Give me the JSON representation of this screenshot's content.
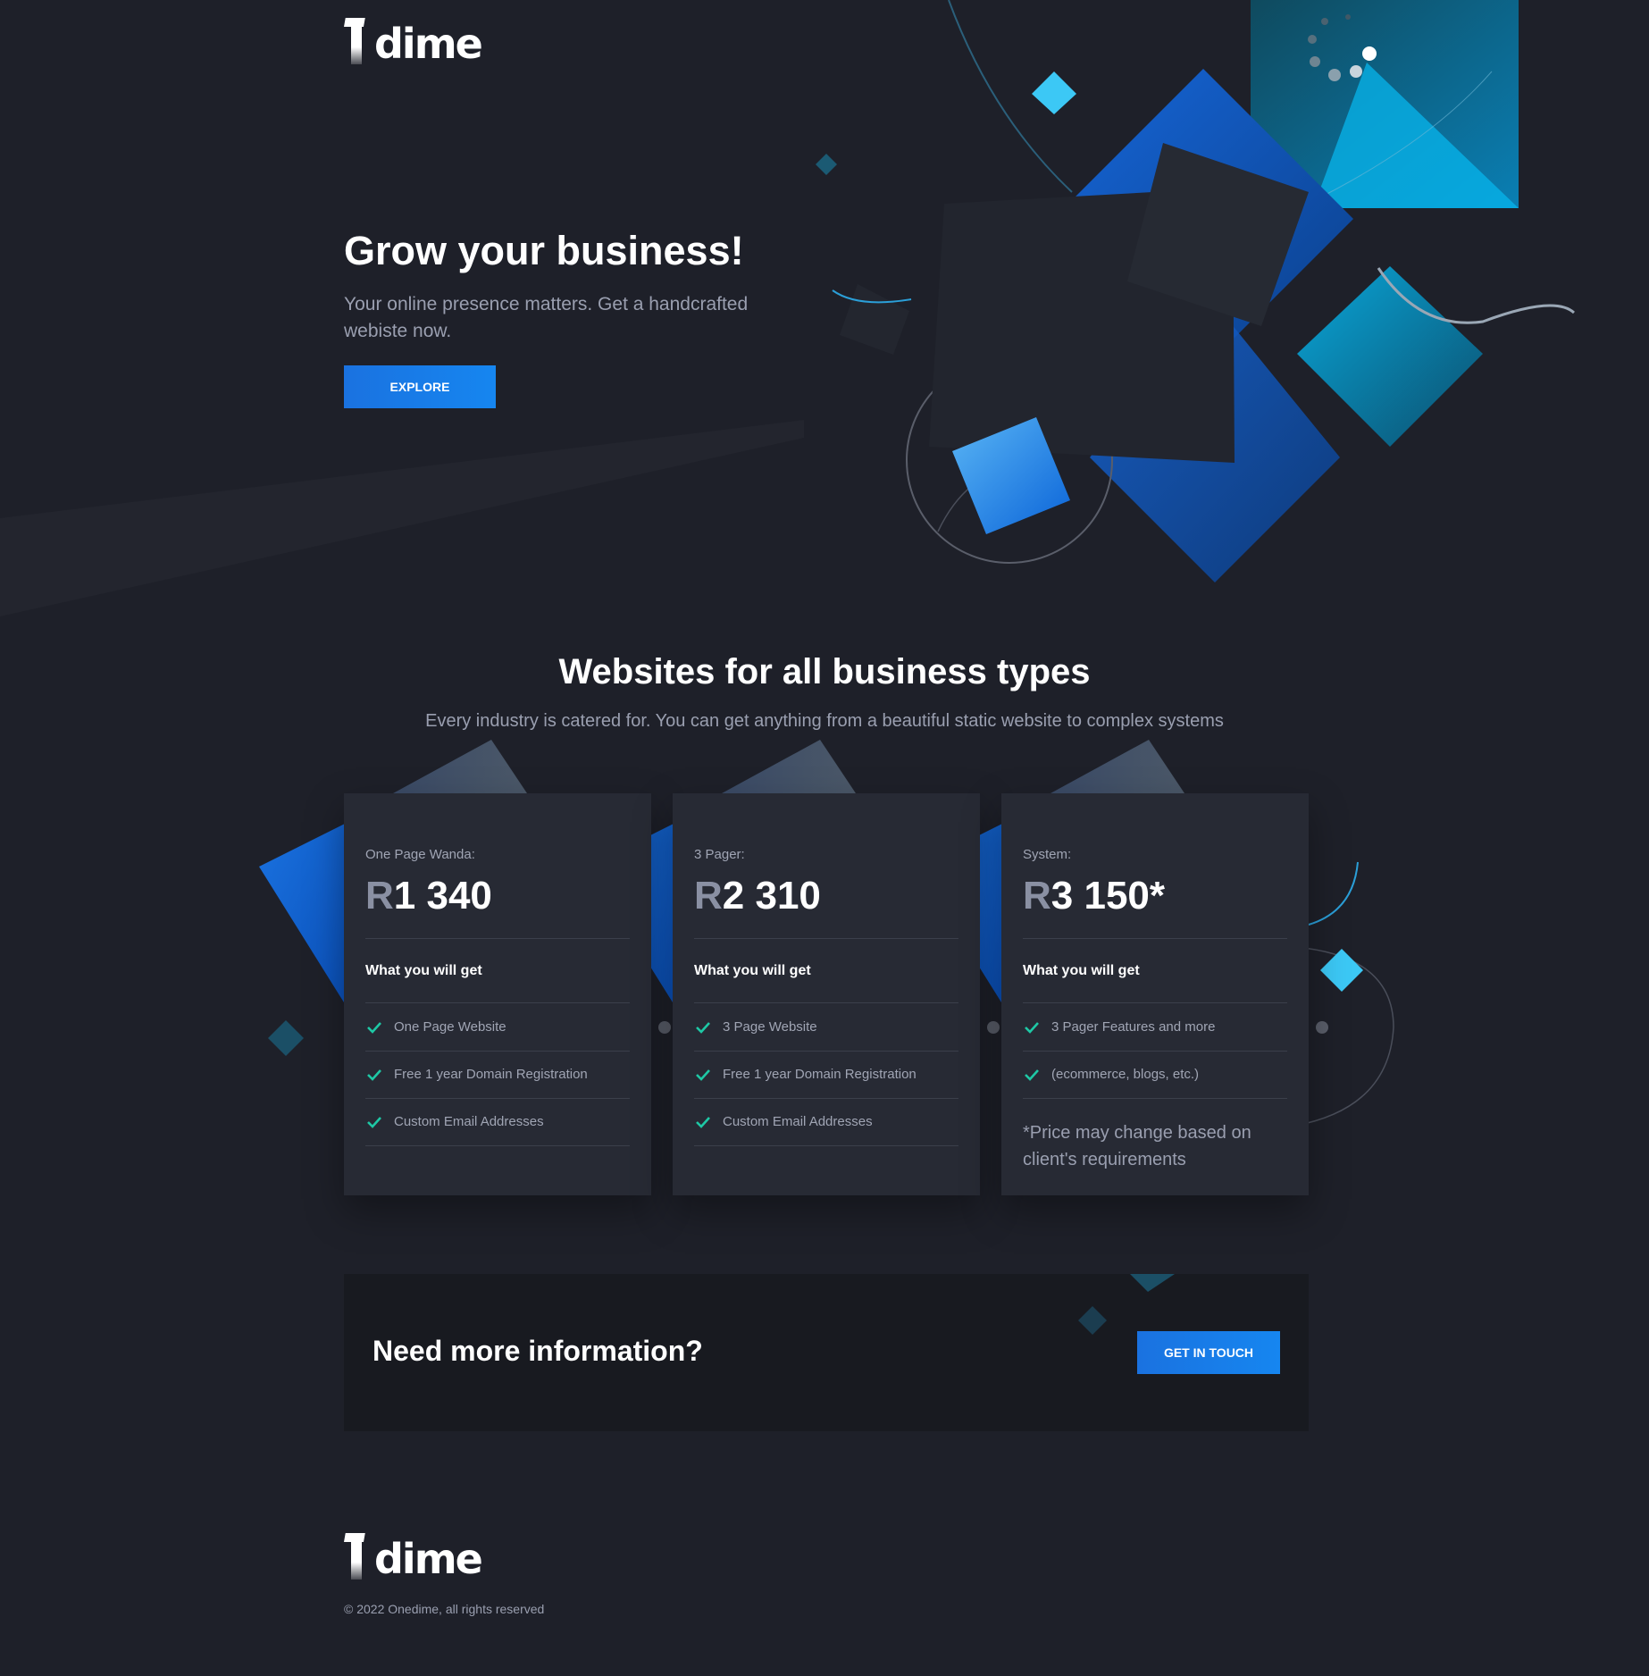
{
  "brand": {
    "name": "dime",
    "logo_glyph": "1"
  },
  "hero": {
    "title": "Grow your business!",
    "subtitle": "Your online presence matters. Get a handcrafted webiste now.",
    "cta_label": "EXPLORE"
  },
  "plans_section": {
    "title": "Websites for all business types",
    "subtitle": "Every industry is catered for. You can get anything from a beautiful static website to complex systems"
  },
  "plans": [
    {
      "tier": "One Page Wanda:",
      "currency": "R",
      "amount": "1 340",
      "features_heading": "What you will get",
      "features": [
        "One Page Website",
        "Free 1 year Domain Registration",
        "Custom Email Addresses"
      ],
      "note": ""
    },
    {
      "tier": "3 Pager:",
      "currency": "R",
      "amount": "2 310",
      "features_heading": "What you will get",
      "features": [
        "3 Page Website",
        "Free 1 year Domain Registration",
        "Custom Email Addresses"
      ],
      "note": ""
    },
    {
      "tier": "System:",
      "currency": "R",
      "amount": "3 150*",
      "features_heading": "What you will get",
      "features": [
        "3 Pager Features and more",
        "(ecommerce, blogs, etc.)"
      ],
      "note": "*Price may change based on client's requirements"
    }
  ],
  "cta_banner": {
    "title": "Need more information?",
    "button_label": "GET IN TOUCH"
  },
  "footer": {
    "copyright": "© 2022 Onedime, all rights reserved"
  },
  "icons": {
    "feature_check": "check-icon"
  },
  "colors": {
    "background": "#1e2029",
    "card": "#272a34",
    "accent": "#1a72e0",
    "check": "#1ec8a5"
  }
}
